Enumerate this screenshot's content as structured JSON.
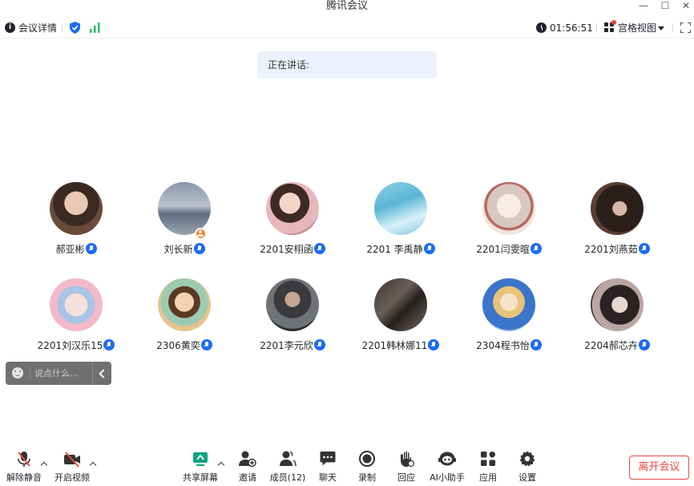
{
  "window": {
    "title": "腾讯会议",
    "min_glyph": "—",
    "max_glyph": "☐",
    "close_glyph": "✕"
  },
  "infobar": {
    "details_label": "会议详情",
    "timer": "01:56:51",
    "view_label": "宫格视图",
    "accent": "#1b6bf2",
    "signal_color": "#2bbf6a"
  },
  "speaking": {
    "label": "正在讲话:"
  },
  "participants": [
    {
      "name": "郝亚彬",
      "avatar_icon": "avatar-photo",
      "host": false,
      "mic": true
    },
    {
      "name": "刘长新",
      "avatar_icon": "avatar-landscape",
      "host": true,
      "mic": true
    },
    {
      "name": "2201安栩函",
      "avatar_icon": "avatar-photo",
      "host": false,
      "mic": true
    },
    {
      "name": "2201 李禹静",
      "avatar_icon": "avatar-illustration",
      "host": false,
      "mic": true
    },
    {
      "name": "2201闫雯暄",
      "avatar_icon": "avatar-illustration",
      "host": false,
      "mic": true
    },
    {
      "name": "2201刘燕茹",
      "avatar_icon": "avatar-photo",
      "host": false,
      "mic": true
    },
    {
      "name": "2201刘汉乐15",
      "avatar_icon": "avatar-illustration",
      "host": false,
      "mic": true
    },
    {
      "name": "2306黄奕",
      "avatar_icon": "avatar-illustration",
      "host": false,
      "mic": true
    },
    {
      "name": "2201李元欣",
      "avatar_icon": "avatar-photo",
      "host": false,
      "mic": false
    },
    {
      "name": "2201韩林娜11",
      "avatar_icon": "avatar-photo",
      "host": false,
      "mic": true
    },
    {
      "name": "2304程书怡",
      "avatar_icon": "avatar-illustration",
      "host": false,
      "mic": true
    },
    {
      "name": "2204郝芯卉",
      "avatar_icon": "avatar-photo",
      "host": false,
      "mic": true
    }
  ],
  "chat": {
    "placeholder": "说点什么..."
  },
  "toolbar": {
    "unmute": "解除静音",
    "start_video": "开启视频",
    "share_screen": "共享屏幕",
    "invite": "邀请",
    "members": "成员(12)",
    "chat": "聊天",
    "record": "录制",
    "reactions": "回应",
    "ai_assistant": "AI小助手",
    "apps": "应用",
    "settings": "设置",
    "leave": "离开会议",
    "danger_color": "#e64a40",
    "share_color": "#0fa37f"
  }
}
